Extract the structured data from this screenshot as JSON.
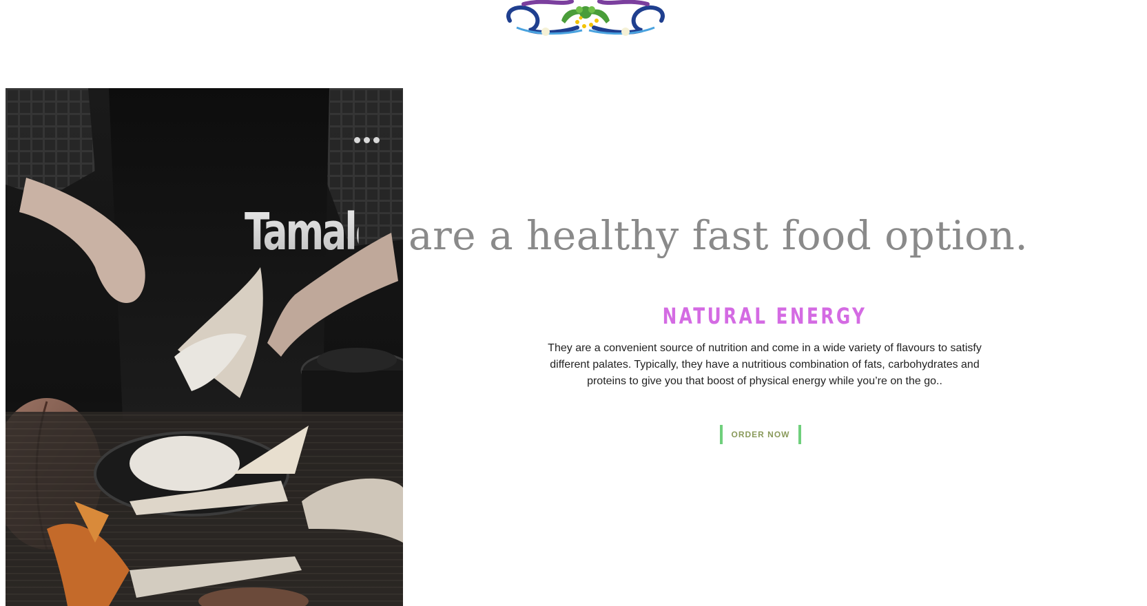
{
  "brand": {
    "logo_icon": "ornamental-flourish"
  },
  "hero": {
    "image_alt": "Hands spreading masa onto a corn husk to make tamales",
    "more_icon": "more-horizontal-dots-icon"
  },
  "headline": {
    "highlight": "Tamales",
    "rest": "are a healthy fast food option."
  },
  "feature": {
    "title": "NATURAL ENERGY",
    "body": "They are a convenient source of nutrition and come in a wide variety of flavours to satisfy different palates. Typically, they have a nutritious combination of fats, carbohydrates and proteins to give you that boost of physical energy while you’re on the go..",
    "cta_label": "ORDER NOW"
  },
  "colors": {
    "title_accent": "#d46be3",
    "button_border": "#6fcf7c",
    "button_text": "#8a9a5b",
    "headline_gray": "#8a8a8a"
  }
}
